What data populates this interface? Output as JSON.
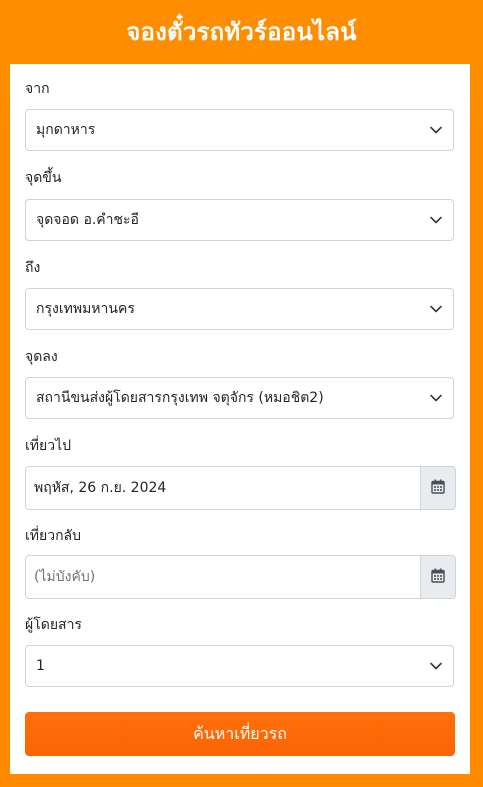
{
  "header": {
    "title": "จองตั๋วรถทัวร์ออนไลน์"
  },
  "form": {
    "from": {
      "label": "จาก",
      "value": "มุกดาหาร"
    },
    "pickup": {
      "label": "จุดขึ้น",
      "value": "จุดจอด อ.คำชะอี"
    },
    "to": {
      "label": "ถึง",
      "value": "กรุงเทพมหานคร"
    },
    "dropoff": {
      "label": "จุดลง",
      "value": "สถานีขนส่งผู้โดยสารกรุงเทพ จตุจักร (หมอชิต2)"
    },
    "depart": {
      "label": "เที่ยวไป",
      "value": "พฤหัส, 26 ก.ย. 2024"
    },
    "return": {
      "label": "เที่ยวกลับ",
      "placeholder": "(ไม่บังคับ)"
    },
    "passengers": {
      "label": "ผู้โดยสาร",
      "value": "1"
    },
    "search_label": "ค้นหาเที่ยวรถ"
  },
  "colors": {
    "background": "#ff8c00",
    "button": "#ff6a08",
    "addon": "#e9ecef",
    "border": "#ced4da"
  },
  "icons": {
    "select": "chevron-down-icon",
    "date": "calendar-icon"
  }
}
